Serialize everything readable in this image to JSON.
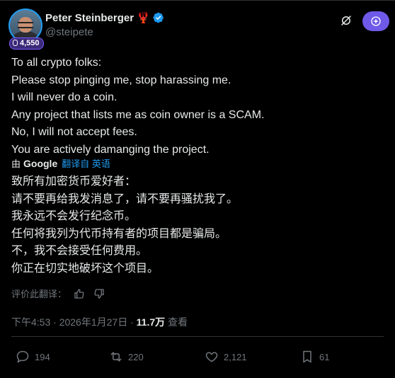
{
  "author": {
    "name": "Peter Steinberger",
    "emoji": "🦞",
    "handle": "@steipete",
    "badge_count": "4,550"
  },
  "tweet": {
    "lines": [
      "To all crypto folks:",
      "Please stop pinging me, stop harassing me.",
      "I will never do a coin.",
      "Any project that lists me as coin owner is a SCAM.",
      "No, I will not accept fees.",
      "You are actively damanging the project."
    ]
  },
  "translation": {
    "by_label": "由",
    "provider": "Google",
    "link_label": "翻译自 英语",
    "lines": [
      "致所有加密货币爱好者：",
      "请不要再给我发消息了，请不要再骚扰我了。",
      "我永远不会发行纪念币。",
      "任何将我列为代币持有者的项目都是骗局。",
      "不，我不会接受任何费用。",
      "你正在切实地破坏这个项目。"
    ],
    "rate_label": "评价此翻译："
  },
  "meta": {
    "time": "下午4:53",
    "separator": "·",
    "date": "2026年1月27日",
    "views": "11.7万",
    "views_label": "查看"
  },
  "actions": {
    "replies": "194",
    "reposts": "220",
    "likes": "2,121",
    "bookmarks": "61"
  },
  "colors": {
    "background": "#000000",
    "text": "#e7e9ea",
    "muted": "#71767b",
    "accent": "#1d9bf0",
    "ai_button": "#6e59e8"
  },
  "icons": [
    "verified-badge-icon",
    "lobster-emoji",
    "grok-icon",
    "ai-sparkle-icon",
    "thumbs-up-icon",
    "thumbs-down-icon",
    "reply-icon",
    "repost-icon",
    "like-icon",
    "bookmark-icon",
    "mic-icon"
  ]
}
